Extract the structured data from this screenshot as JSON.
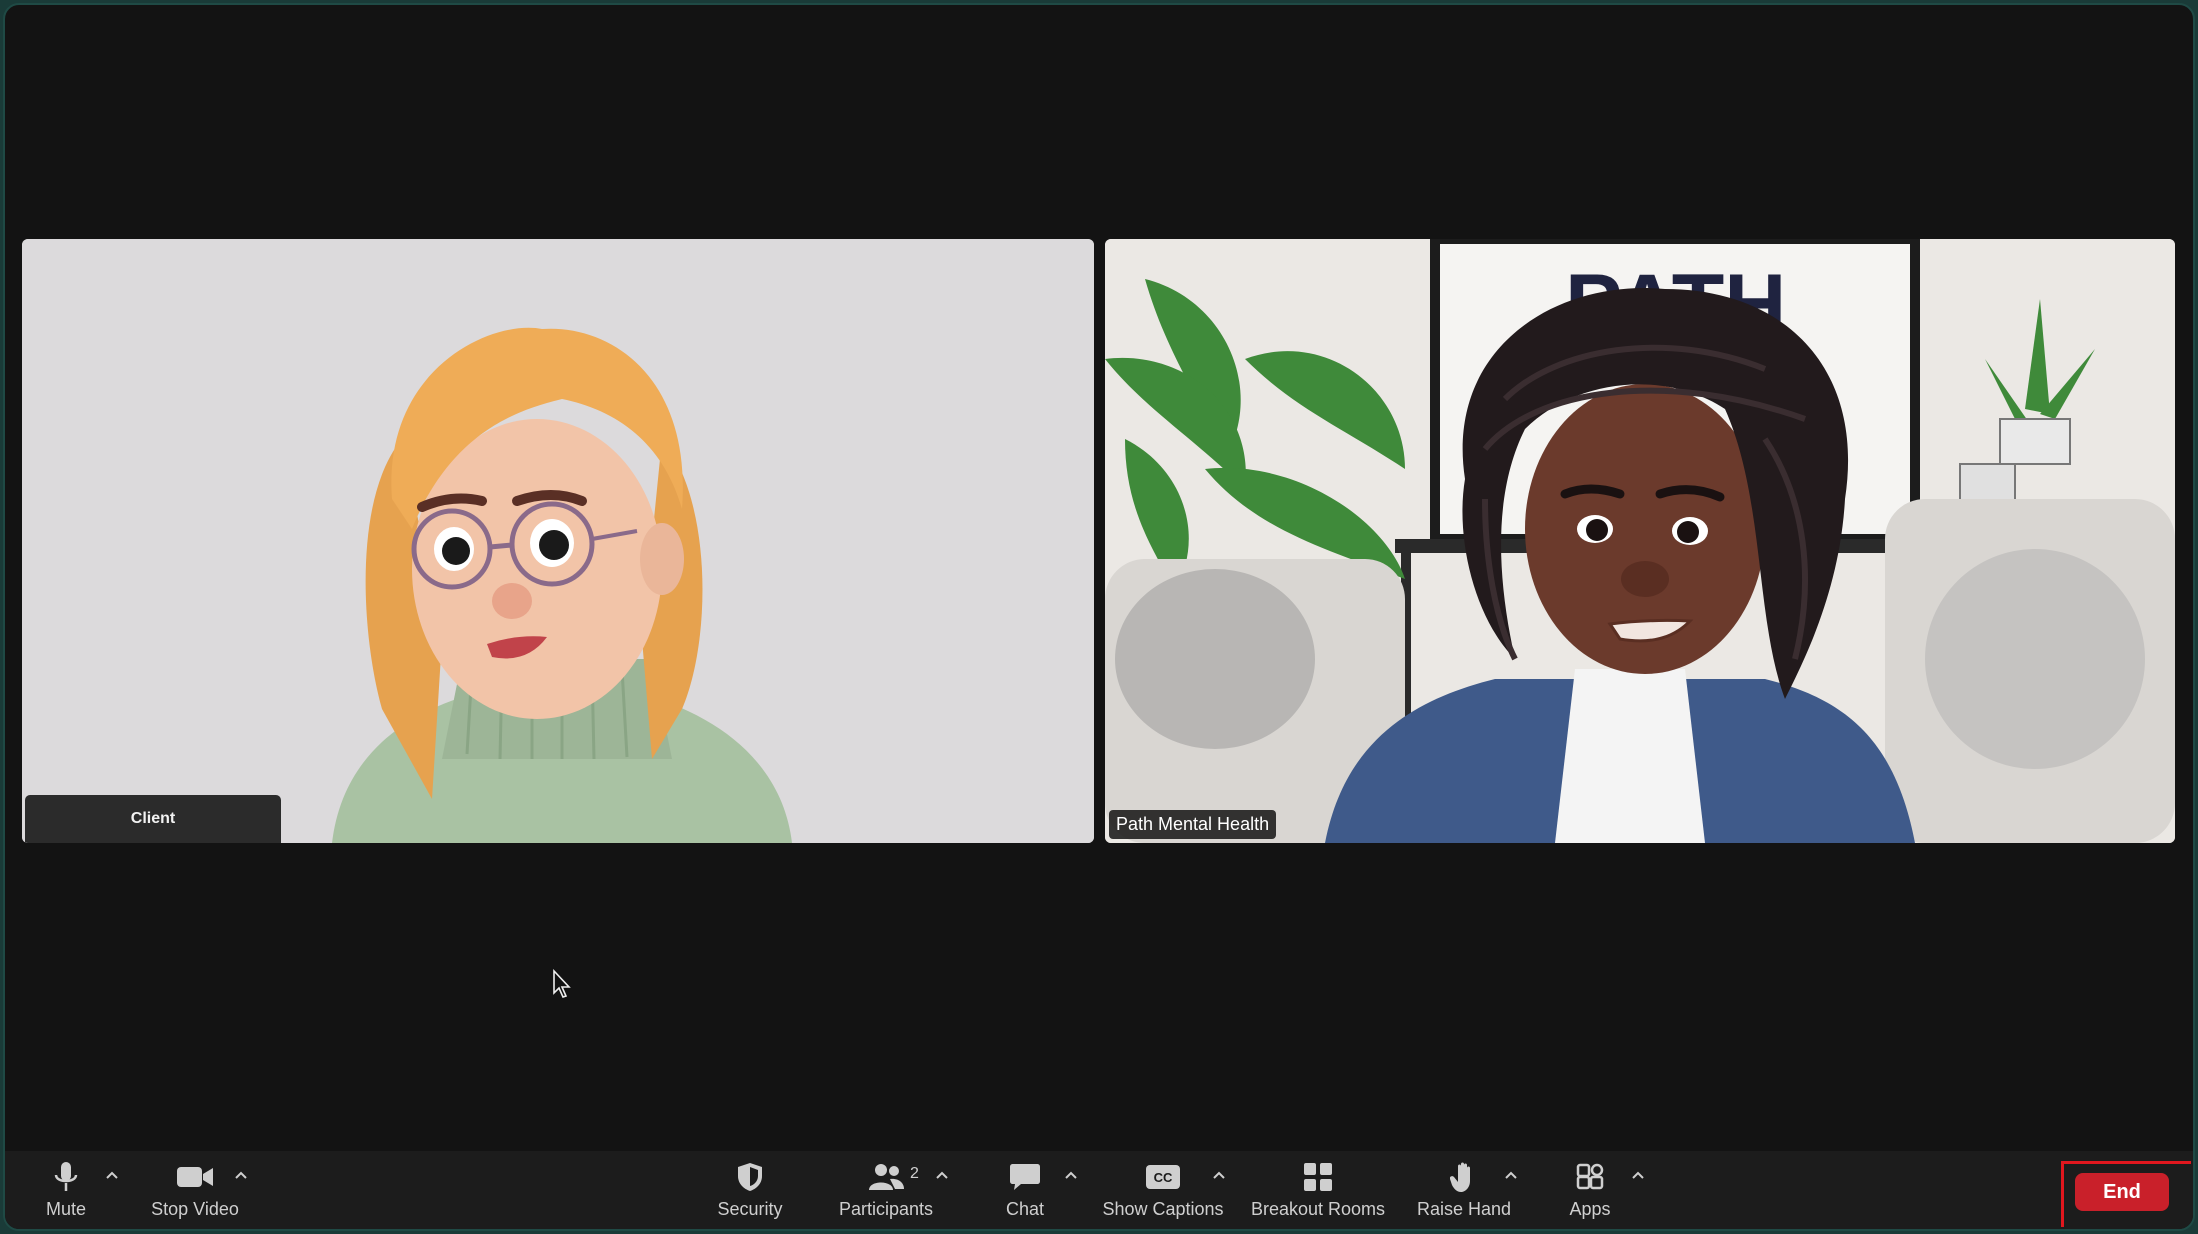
{
  "participants": {
    "left": {
      "name": "Client"
    },
    "right": {
      "name": "Path Mental Health",
      "backdrop_text": "PATH"
    }
  },
  "toolbar": {
    "mute": {
      "label": "Mute",
      "icon": "microphone-icon"
    },
    "stop_video": {
      "label": "Stop Video",
      "icon": "video-camera-icon"
    },
    "security": {
      "label": "Security",
      "icon": "shield-icon"
    },
    "participants": {
      "label": "Participants",
      "count": "2",
      "icon": "people-icon"
    },
    "chat": {
      "label": "Chat",
      "icon": "chat-bubble-icon"
    },
    "captions": {
      "label": "Show Captions",
      "icon_text": "CC",
      "icon": "captions-icon"
    },
    "breakout": {
      "label": "Breakout Rooms",
      "icon": "grid-icon"
    },
    "raise_hand": {
      "label": "Raise Hand",
      "icon": "hand-icon"
    },
    "apps": {
      "label": "Apps",
      "icon": "apps-icon"
    },
    "end": {
      "label": "End"
    }
  },
  "colors": {
    "window_bg": "#131313",
    "toolbar_bg": "#1c1c1c",
    "end_button": "#c9202a",
    "highlight_frame": "#e0171e"
  }
}
